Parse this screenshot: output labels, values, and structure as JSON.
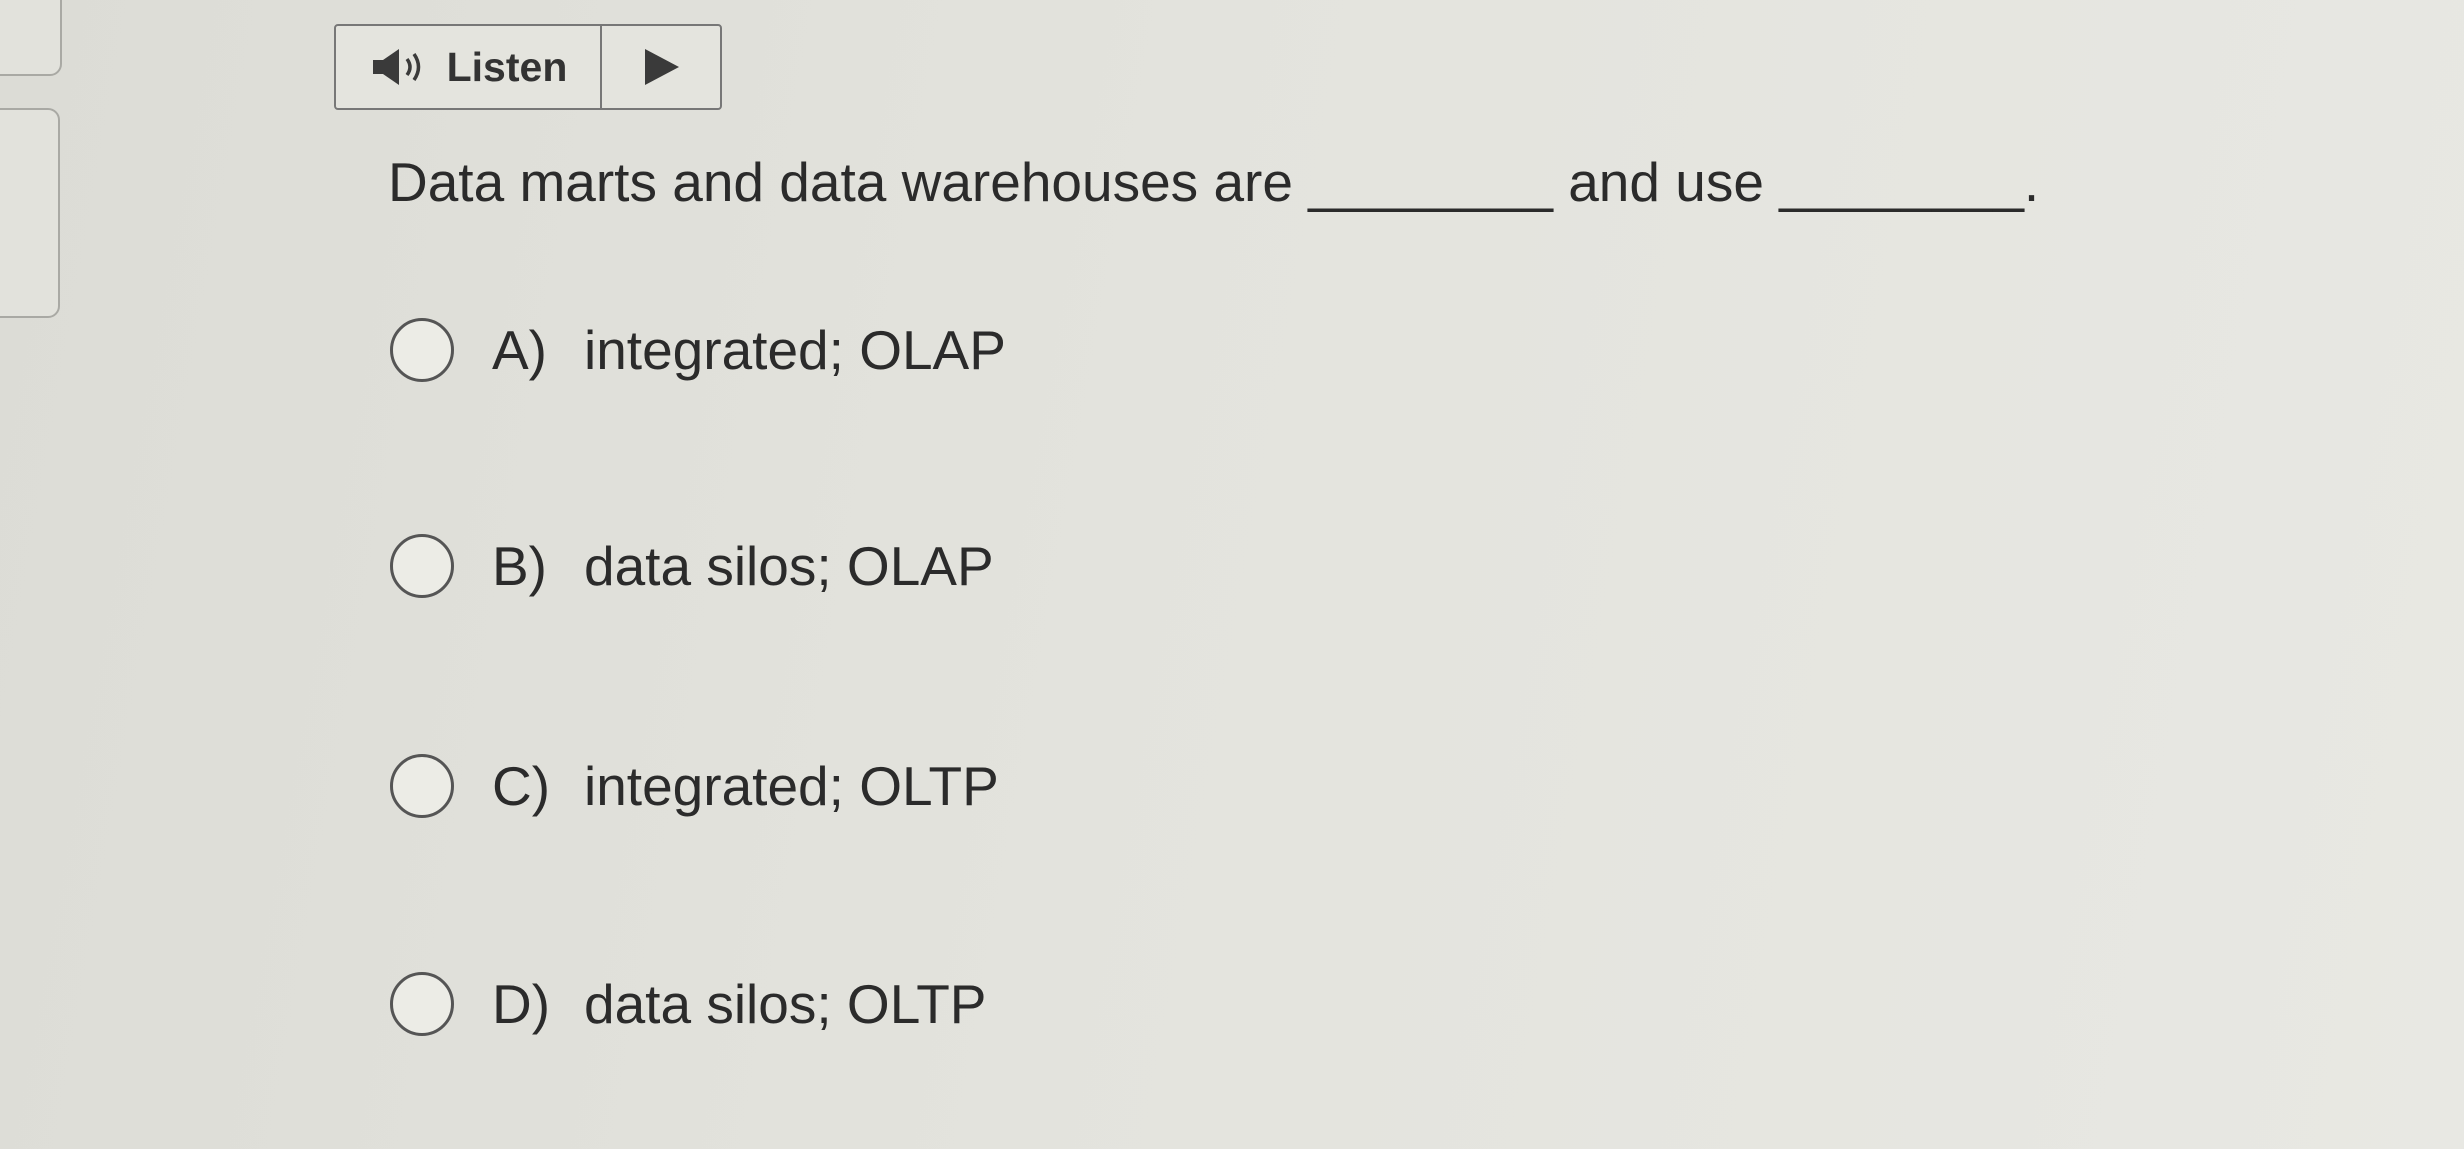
{
  "listen": {
    "label": "Listen"
  },
  "question": {
    "text": "Data marts and data warehouses are ________ and use ________."
  },
  "options": [
    {
      "letter": "A)",
      "text": "integrated; OLAP"
    },
    {
      "letter": "B)",
      "text": "data silos; OLAP"
    },
    {
      "letter": "C)",
      "text": "integrated; OLTP"
    },
    {
      "letter": "D)",
      "text": "data silos; OLTP"
    }
  ],
  "colors": {
    "background": "#e3e3dd",
    "border": "#777777",
    "text": "#2b2b2b"
  },
  "icons": {
    "listen": "speaker-icon",
    "play": "play-icon"
  }
}
